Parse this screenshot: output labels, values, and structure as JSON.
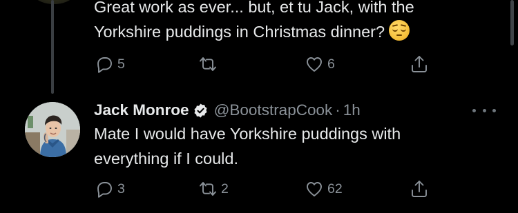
{
  "parent_tweet": {
    "text_line1": "Great work as ever... but, et tu Jack, with the",
    "text_line2": "Yorkshire puddings in Christmas dinner?",
    "emoji": "pensive-face-emoji",
    "reply_count": "5",
    "retweet_count": "",
    "like_count": "6"
  },
  "reply_tweet": {
    "display_name": "Jack Monroe",
    "handle": "@BootstrapCook",
    "separator": "·",
    "time": "1h",
    "text_line1": "Mate I would have Yorkshire puddings with",
    "text_line2": "everything if I could.",
    "reply_count": "3",
    "retweet_count": "2",
    "like_count": "62"
  },
  "icons": {
    "reply": "reply-icon",
    "retweet": "retweet-icon",
    "like": "heart-icon",
    "share": "share-icon",
    "verified": "verified-badge-icon",
    "more": "more-dots-icon"
  },
  "colors": {
    "background": "#000000",
    "text_primary": "#e7e9ea",
    "text_secondary": "#8b9299",
    "thread_line": "#3a3e42"
  }
}
